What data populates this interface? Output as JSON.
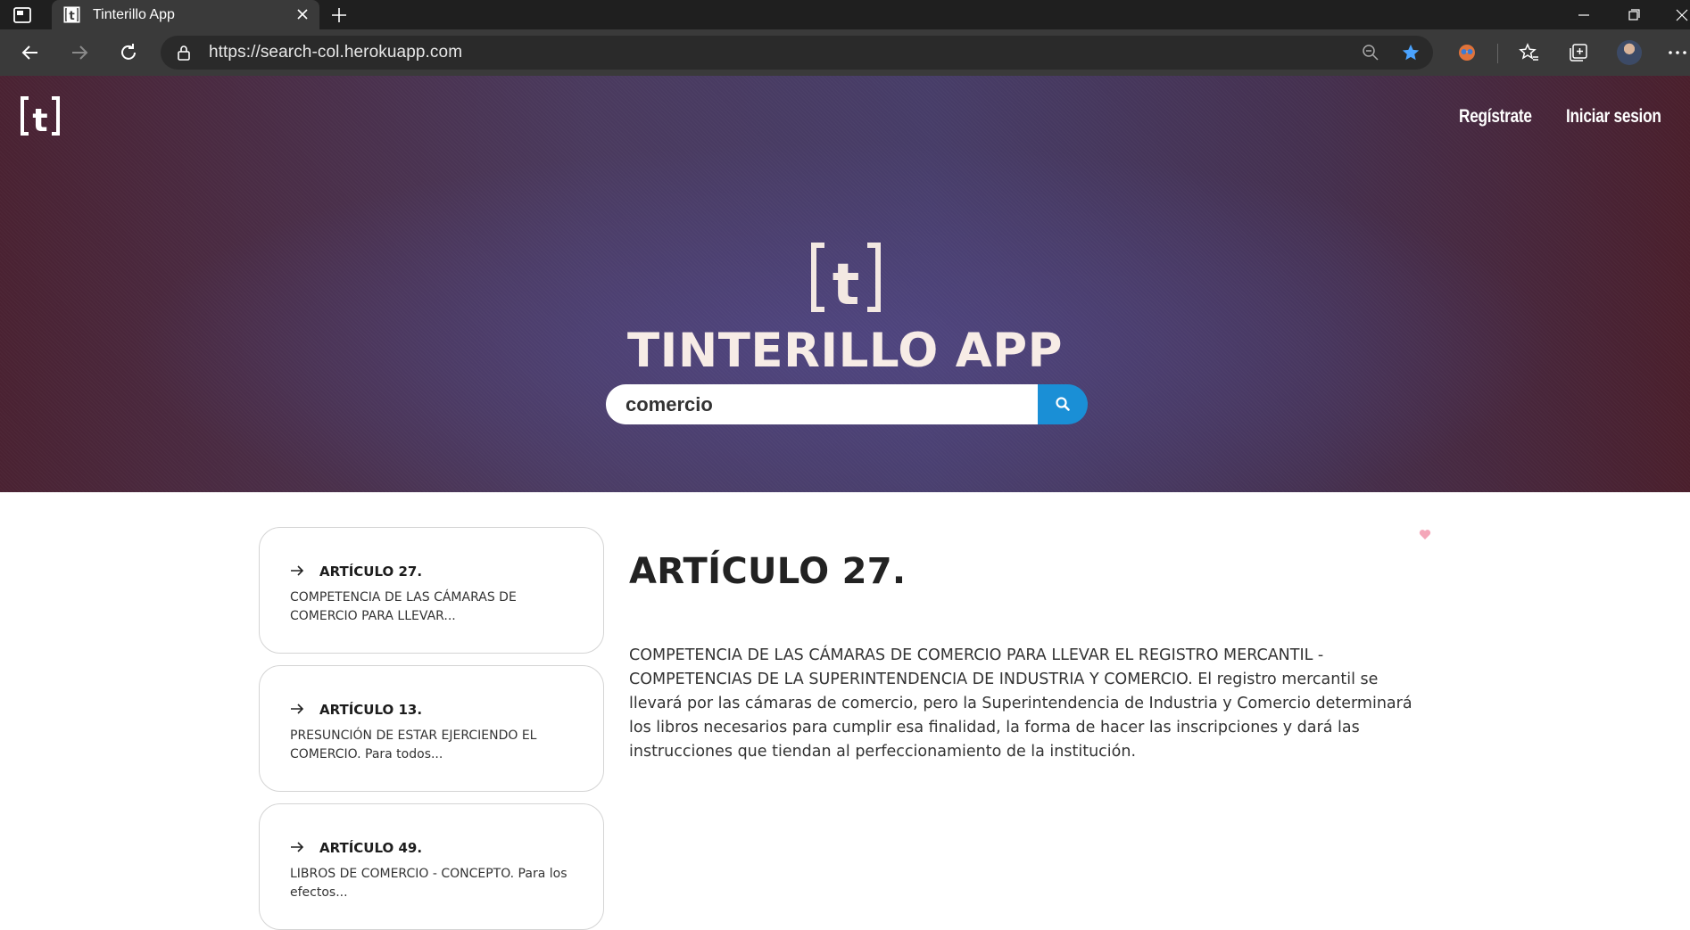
{
  "browser": {
    "tab_title": "Tinterillo App",
    "url": "https://search-col.herokuapp.com"
  },
  "header": {
    "nav": {
      "register": "Regístrate",
      "login": "Iniciar sesion"
    },
    "app_title": "TINTERILLO APP"
  },
  "search": {
    "value": "comercio",
    "placeholder": ""
  },
  "results": [
    {
      "title": "ARTÍCULO 27.",
      "snippet": "COMPETENCIA DE LAS CÁMARAS DE COMERCIO PARA LLEVAR..."
    },
    {
      "title": "ARTÍCULO 13.",
      "snippet": "PRESUNCIÓN DE ESTAR EJERCIENDO EL COMERCIO. Para todos..."
    },
    {
      "title": "ARTÍCULO 49.",
      "snippet": "LIBROS DE COMERCIO - CONCEPTO. Para los efectos..."
    }
  ],
  "article": {
    "title": "ARTÍCULO 27.",
    "body": "COMPETENCIA DE LAS CÁMARAS DE COMERCIO PARA LLEVAR EL REGISTRO MERCANTIL - COMPETENCIAS DE LA SUPERINTENDENCIA DE INDUSTRIA Y COMERCIO. El registro mercantil se llevará por las cámaras de comercio, pero la Superintendencia de Industria y Comercio determinará los libros necesarios para cumplir esa finalidad, la forma de hacer las inscripciones y dará las instrucciones que tiendan al perfeccionamiento de la institución."
  },
  "colors": {
    "search_button": "#1a8fd6",
    "hero_left": "#4a2232",
    "hero_center": "#473d68",
    "hero_title": "#f7ece6",
    "heart": "#f4a7b9"
  },
  "icons": [
    "tab-actions-icon",
    "tinterillo-logo-icon",
    "close-icon",
    "plus-icon",
    "back-arrow-icon",
    "forward-arrow-icon",
    "reload-icon",
    "lock-icon",
    "zoom-out-icon",
    "star-icon",
    "extension-icon",
    "favorites-icon",
    "collections-icon",
    "more-icon",
    "search-icon",
    "arrow-right-icon",
    "heart-icon"
  ]
}
